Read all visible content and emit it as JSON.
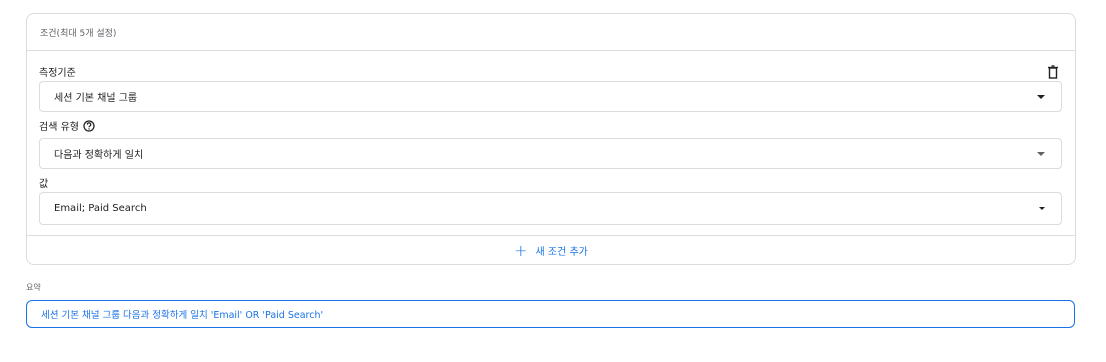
{
  "conditions": {
    "header": "조건(최대 5개 설정)",
    "metric_label": "측정기준",
    "metric_value": "세션 기본 채널 그룹",
    "match_type_label": "검색 유형",
    "match_type_value": "다음과 정확하게 일치",
    "value_label": "값",
    "value_value": "Email; Paid Search",
    "add_condition": "새 조건 추가",
    "add_icon": "+"
  },
  "summary": {
    "label": "요약",
    "text": "세션 기본 채널 그룹 다음과 정확하게 일치 'Email' OR 'Paid Search'"
  },
  "colors": {
    "accent": "#1a73e8",
    "border": "#dadce0",
    "text": "#202124",
    "muted": "#5f6368"
  },
  "icons": [
    "trash-icon",
    "help-icon",
    "dropdown-caret-icon",
    "plus-icon"
  ]
}
